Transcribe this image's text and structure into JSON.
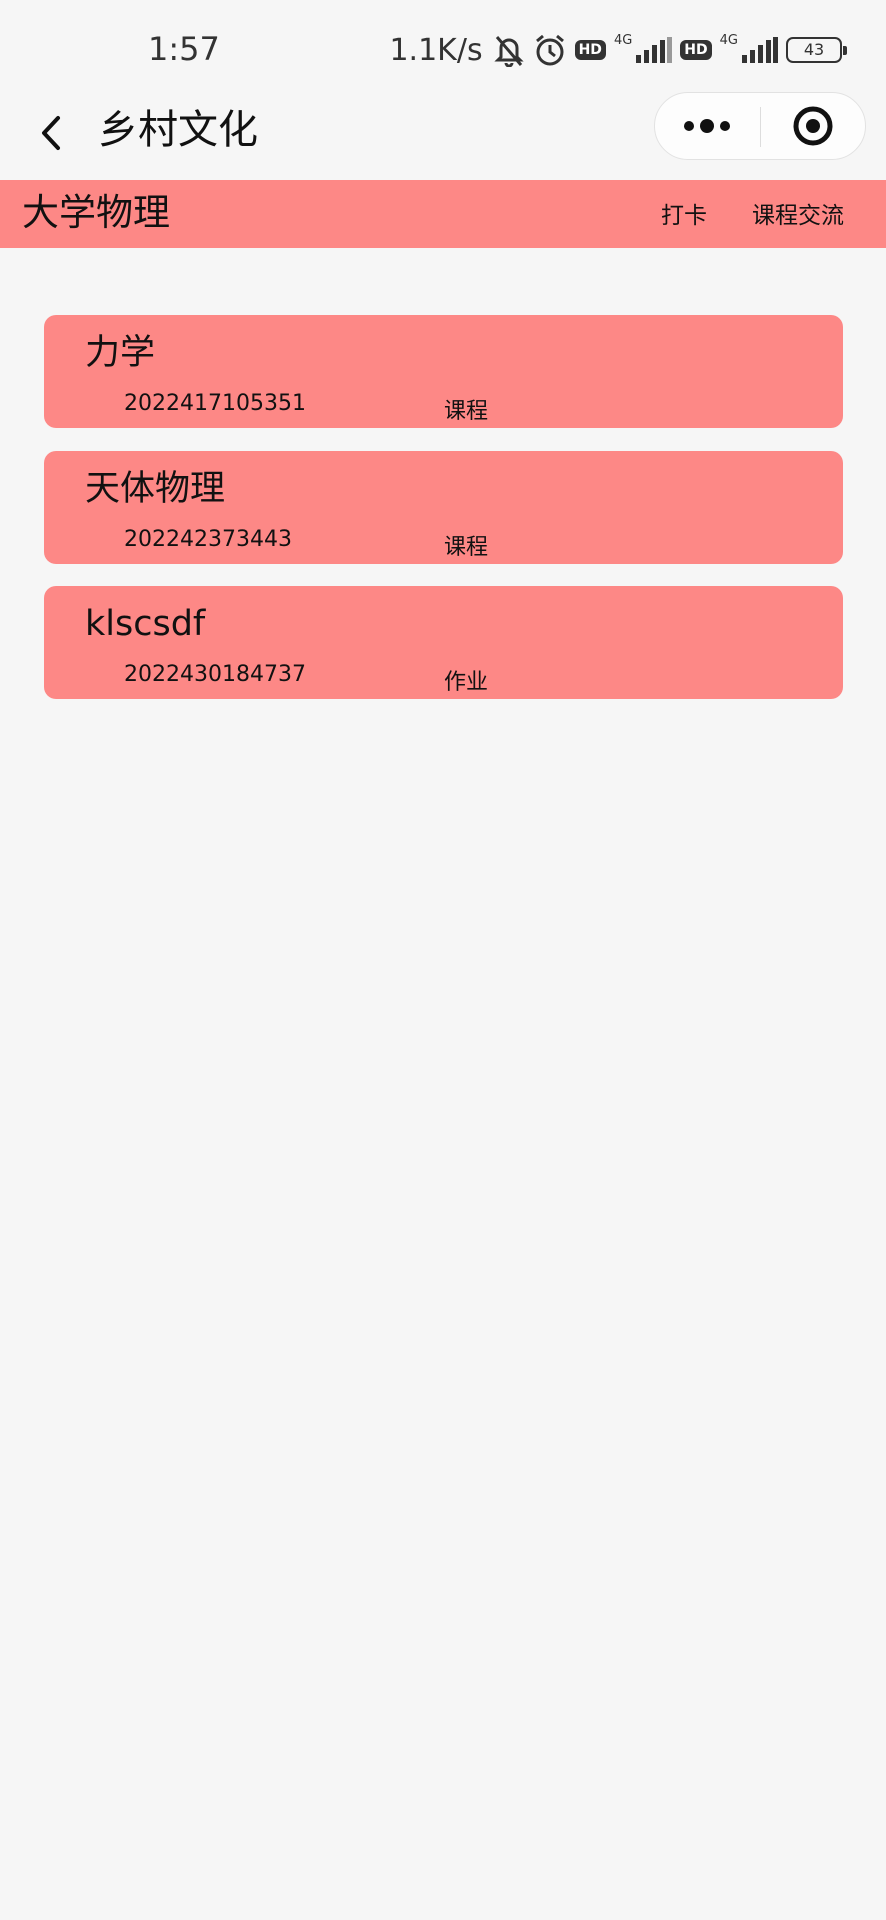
{
  "status_bar": {
    "time": "1:57",
    "net_speed": "1.1K/s",
    "hd_label": "HD",
    "network_label": "4G",
    "battery": "43",
    "icons": [
      "bell-off-icon",
      "alarm-icon",
      "hd-icon",
      "signal-icon",
      "hd-icon",
      "signal-icon",
      "battery-icon"
    ]
  },
  "nav": {
    "title": "乡村文化",
    "back_icon": "chevron-left-icon",
    "more_icon": "more-dots-icon",
    "close_icon": "target-icon"
  },
  "header": {
    "title": "大学物理",
    "links": [
      "打卡",
      "课程交流"
    ]
  },
  "items": [
    {
      "name": "力学",
      "id": "2022417105351",
      "type": "课程"
    },
    {
      "name": "天体物理",
      "id": "202242373443",
      "type": "课程"
    },
    {
      "name": "klscsdf",
      "id": "2022430184737",
      "type": "作业"
    }
  ],
  "colors": {
    "accent": "#fd8886",
    "background": "#f6f6f6",
    "text": "#111111"
  }
}
